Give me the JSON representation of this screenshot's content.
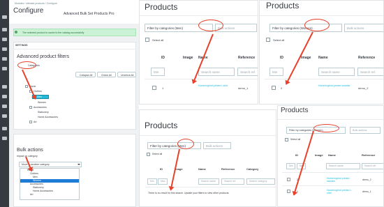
{
  "left": {
    "breadcrumb": "Modules  /  ultimate products  /  Configure",
    "title": "Configure",
    "subtitle": "Advanced Bulk Set Products Pro",
    "success": "The selected product is saved to the catalog successfully",
    "settings_tab": "SETTINGS",
    "filters_title": "Advanced product filters",
    "categories_chip": "Categories",
    "collapse_all": "Collapse All",
    "check_all": "Check All",
    "uncheck_all": "Uncheck All",
    "tree": [
      "Home",
      "Clothes",
      "Men",
      "Women",
      "Accessories",
      "Stationery",
      "Home Accessories",
      "Art"
    ],
    "bulk_title": "Bulk actions",
    "bulk_label": "Impact on category",
    "bulk_select": "Move to another category",
    "dropdown": [
      "Home",
      "Clothes",
      "Men",
      "Women",
      "Accessories",
      "Stationery",
      "Home Accessories",
      "Art"
    ]
  },
  "p1": {
    "title": "Products",
    "filter": "Filter by categories (Men)",
    "bulk": "Bulk actions",
    "select_all": "Select all",
    "cols": [
      "ID",
      "Image",
      "Name",
      "Reference"
    ],
    "min": "Min",
    "max": "Max",
    "search_name": "Search name",
    "search_ref": "Search ref.",
    "row": {
      "id": "1",
      "name": "Hummingbird printed t-shirt",
      "ref": "demo_1"
    }
  },
  "p2": {
    "title": "Products",
    "filter": "Filter by categories (Women)",
    "bulk": "Bulk actions",
    "select_all": "Select all",
    "cols": [
      "ID",
      "Image",
      "Name",
      "Reference"
    ],
    "min": "Min",
    "max": "Max",
    "search_name": "Search name",
    "search_ref": "Search ref.",
    "row": {
      "id": "2",
      "name": "Hummingbird printed sweater",
      "ref": "demo_2"
    }
  },
  "p3": {
    "title": "Products",
    "filter": "Filter by categories (Men)",
    "bulk": "Bulk actions",
    "select_all": "Select all",
    "cols": [
      "ID",
      "Image",
      "Name",
      "Reference",
      "Category"
    ],
    "min": "Min",
    "max": "Max",
    "search_name": "Search name",
    "search_ref": "Search ref.",
    "search_cat": "Search category",
    "empty": "There is no result for this search. Update your filters to view other products."
  },
  "p4": {
    "title": "Products",
    "filter": "Filter by categories (Women)",
    "bulk": "Bulk actions",
    "select_all": "Select all",
    "cols": [
      "ID",
      "Image",
      "Name",
      "Reference"
    ],
    "min": "Min",
    "max": "Max",
    "search_name": "Search name",
    "search_ref": "Search ref.",
    "rows": [
      {
        "id": "2",
        "name": "Hummingbird printed sweater",
        "ref": "demo_2"
      },
      {
        "id": "1",
        "name": "Hummingbird printed t-shirt",
        "ref": "demo_1"
      }
    ]
  }
}
